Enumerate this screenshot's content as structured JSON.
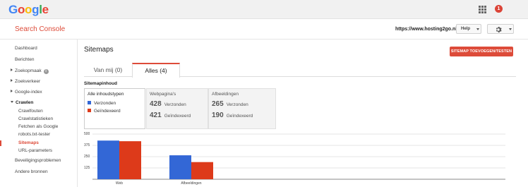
{
  "topbar": {
    "logo_letters": [
      {
        "ch": "G",
        "color": "#4285f4"
      },
      {
        "ch": "o",
        "color": "#ea4335"
      },
      {
        "ch": "o",
        "color": "#fbbc05"
      },
      {
        "ch": "g",
        "color": "#4285f4"
      },
      {
        "ch": "l",
        "color": "#34a853"
      },
      {
        "ch": "e",
        "color": "#ea4335"
      }
    ],
    "notification_count": "1"
  },
  "header": {
    "product_name": "Search Console",
    "site_url": "https://www.hosting2go.nl/",
    "help_label": "Help"
  },
  "sidebar": {
    "items": [
      {
        "label": "Dashboard"
      },
      {
        "label": "Berichten"
      },
      {
        "label": "Zoekopmaak"
      },
      {
        "label": "Zoekverkeer"
      },
      {
        "label": "Google-index"
      },
      {
        "label": "Crawlen"
      },
      {
        "label": "Crawlfouten"
      },
      {
        "label": "Crawlstatistieken"
      },
      {
        "label": "Fetchen als Google"
      },
      {
        "label": "robots.txt-tester"
      },
      {
        "label": "Sitemaps"
      },
      {
        "label": "URL-parameters"
      },
      {
        "label": "Beveiligingsproblemen"
      },
      {
        "label": "Andere bronnen"
      }
    ]
  },
  "main": {
    "page_title": "Sitemaps",
    "add_button": "SITEMAP TOEVOEGEN/TESTEN",
    "tabs": [
      {
        "label": "Van mij (0)"
      },
      {
        "label": "Alles (4)"
      }
    ],
    "section_label": "Sitemapinhoud",
    "filter": {
      "title": "Alle inhoudstypen",
      "legend": [
        {
          "label": "Verzonden",
          "color": "#3367d6"
        },
        {
          "label": "Geïndexeerd",
          "color": "#dd3a1a"
        }
      ]
    },
    "stats": [
      {
        "title": "Webpagina's",
        "submitted": "428",
        "submitted_label": "Verzonden",
        "indexed": "421",
        "indexed_label": "Geïndexeerd"
      },
      {
        "title": "Afbeeldingen",
        "submitted": "265",
        "submitted_label": "Verzonden",
        "indexed": "190",
        "indexed_label": "Geïndexeerd"
      }
    ]
  },
  "chart_data": {
    "type": "bar",
    "categories": [
      "Web",
      "Afbeeldingen"
    ],
    "series": [
      {
        "name": "Verzonden",
        "values": [
          428,
          265
        ],
        "color": "#3367d6"
      },
      {
        "name": "Geïndexeerd",
        "values": [
          421,
          190
        ],
        "color": "#dd3a1a"
      }
    ],
    "y_ticks": [
      "500",
      "375",
      "250",
      "125"
    ],
    "ylim": [
      0,
      500
    ],
    "grid": true
  }
}
